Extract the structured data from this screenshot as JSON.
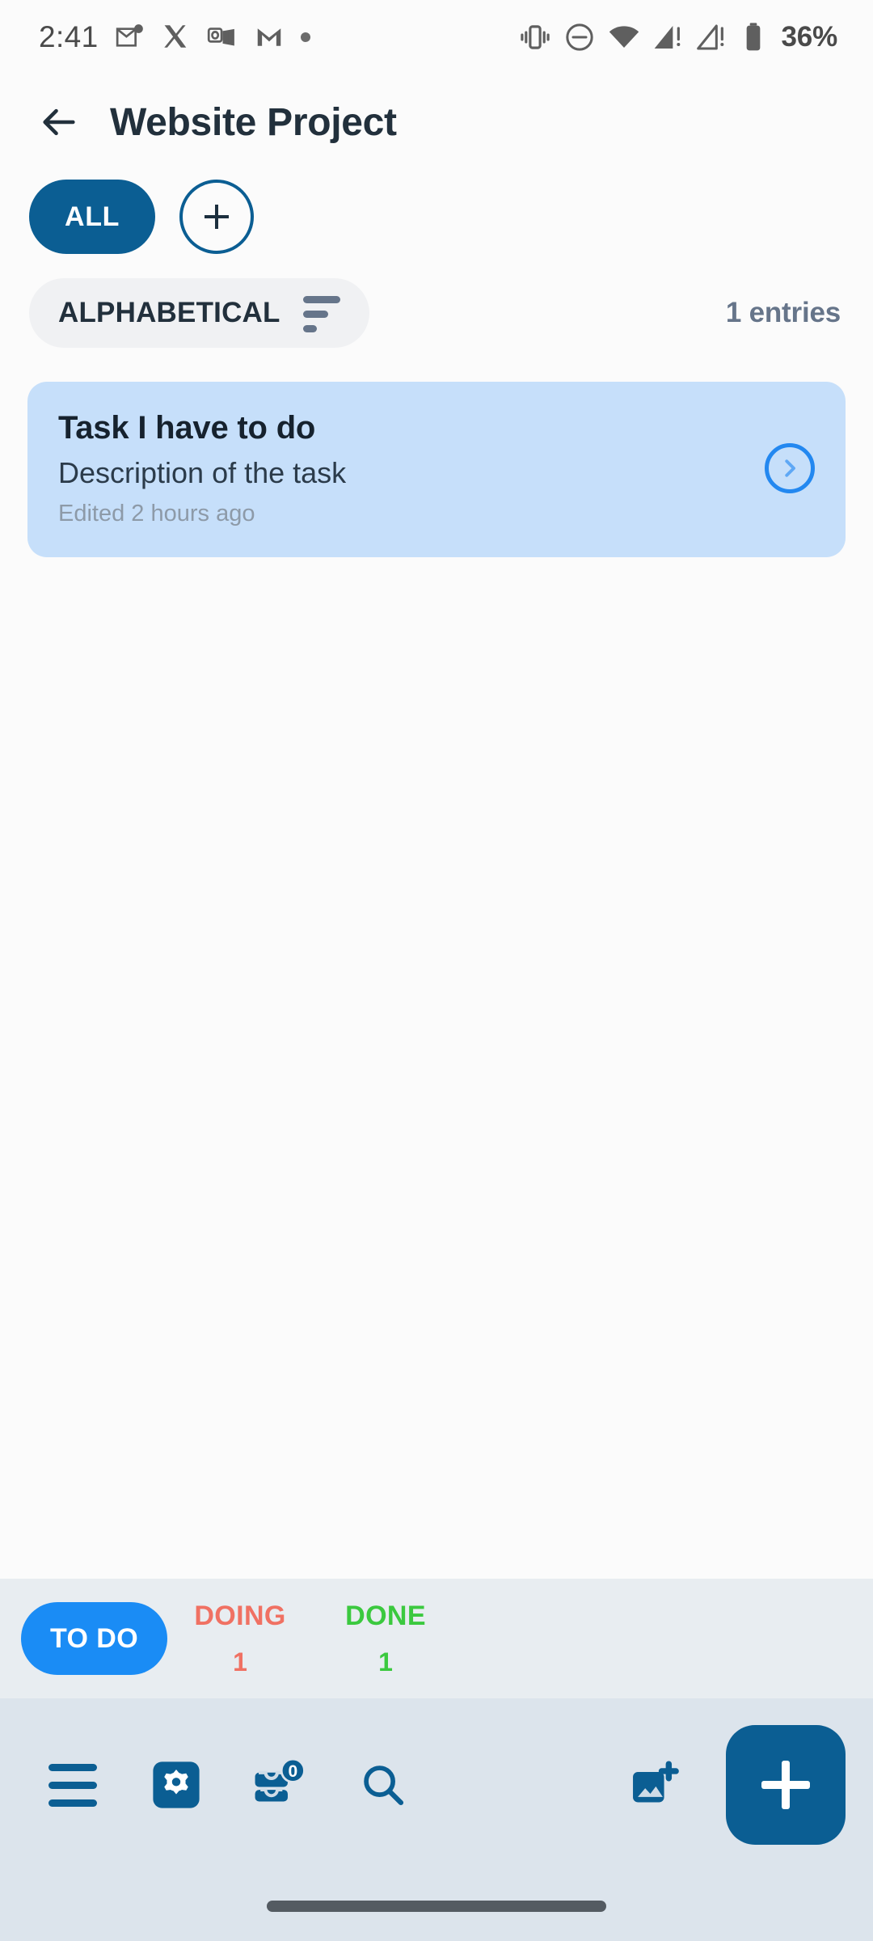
{
  "statusbar": {
    "clock": "2:41",
    "battery_percent": "36%",
    "left_icons": [
      "mail-unread-icon",
      "x-twitter-icon",
      "outlook-icon",
      "gmail-icon",
      "more-notifications-dot-icon"
    ],
    "right_icons": [
      "vibrate-icon",
      "do-not-disturb-icon",
      "wifi-icon",
      "signal-sim1-warning-icon",
      "signal-sim2-warning-icon",
      "battery-icon"
    ]
  },
  "appbar": {
    "back_label": "back-arrow",
    "title": "Website Project"
  },
  "filters": {
    "all_label": "ALL",
    "add_label": "+"
  },
  "sort": {
    "label": "ALPHABETICAL",
    "entries_count": "1 entries"
  },
  "tasks": [
    {
      "title": "Task I have to do",
      "description": "Description of the task",
      "edited": "Edited 2 hours ago"
    }
  ],
  "status_tabs": [
    {
      "label": "TO DO",
      "count": "",
      "active": true,
      "color": "#1a8cf5"
    },
    {
      "label": "DOING",
      "count": "1",
      "active": false,
      "color": "#f07163"
    },
    {
      "label": "DONE",
      "count": "1",
      "active": false,
      "color": "#3bc93f"
    }
  ],
  "bottom_nav": {
    "menu": "menu-icon",
    "settings": "gear-icon",
    "inbox": "inbox-icon",
    "inbox_badge": "0",
    "search": "search-icon",
    "add_image": "add-image-icon",
    "fab": "+"
  },
  "colors": {
    "primary": "#0b5e93",
    "accent_blue": "#1a8cf5",
    "card_bg": "#c6dffa",
    "doing": "#f07163",
    "done": "#3bc93f",
    "strip_bg": "#e8edf1",
    "nav_bg": "#dce4ec"
  }
}
